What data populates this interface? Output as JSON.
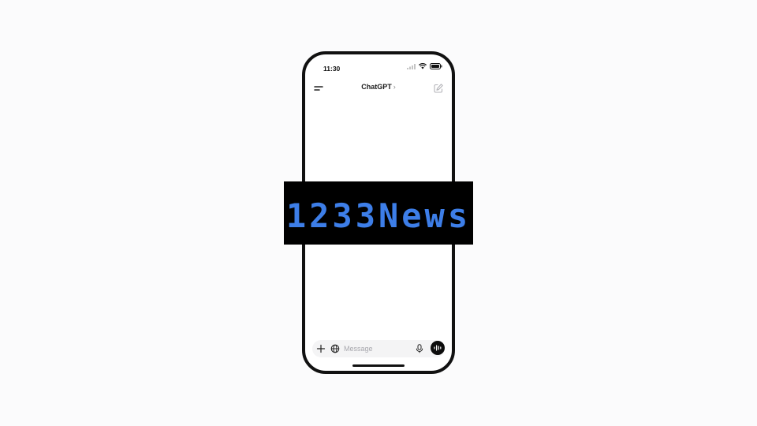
{
  "status_bar": {
    "time": "11:30"
  },
  "nav": {
    "title": "ChatGPT",
    "title_chevron": "›"
  },
  "composer": {
    "placeholder": "Message"
  },
  "watermark": {
    "text": "1233News",
    "text_color": "#3d7ee8",
    "background": "#000000"
  },
  "icons": {
    "menu": "menu-icon",
    "compose": "new-chat-icon",
    "plus": "plus-icon",
    "globe": "globe-icon",
    "mic": "microphone-icon",
    "voice": "voice-mode-icon",
    "signal": "cellular-signal-icon",
    "wifi": "wifi-icon",
    "battery": "battery-icon"
  }
}
